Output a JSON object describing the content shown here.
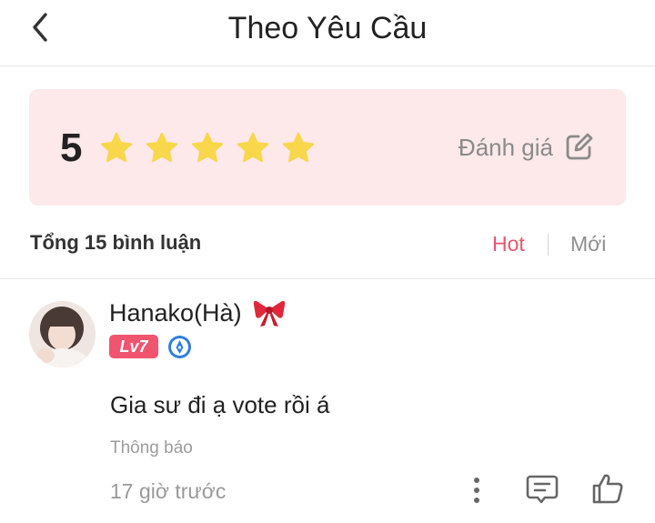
{
  "header": {
    "title": "Theo Yêu Cầu",
    "back_icon": "chevron-left-icon"
  },
  "rating": {
    "score": "5",
    "star_count": 5,
    "star_color": "#f8d74a",
    "rate_label": "Đánh giá",
    "rate_icon": "edit-icon"
  },
  "comments_summary": {
    "total_label": "Tổng 15 bình luận",
    "sort_hot": "Hot",
    "sort_new": "Mới",
    "active_color": "#e5566f"
  },
  "comment": {
    "username": "Hanako(Hà)",
    "name_decoration": "ribbon-bow-icon",
    "level_badge": "Lv7",
    "text": "Gia sư đi ạ vote rồi á",
    "notice_label": "Thông báo",
    "time": "17 giờ trước",
    "actions": [
      "more-icon",
      "reply-icon",
      "like-icon"
    ]
  }
}
